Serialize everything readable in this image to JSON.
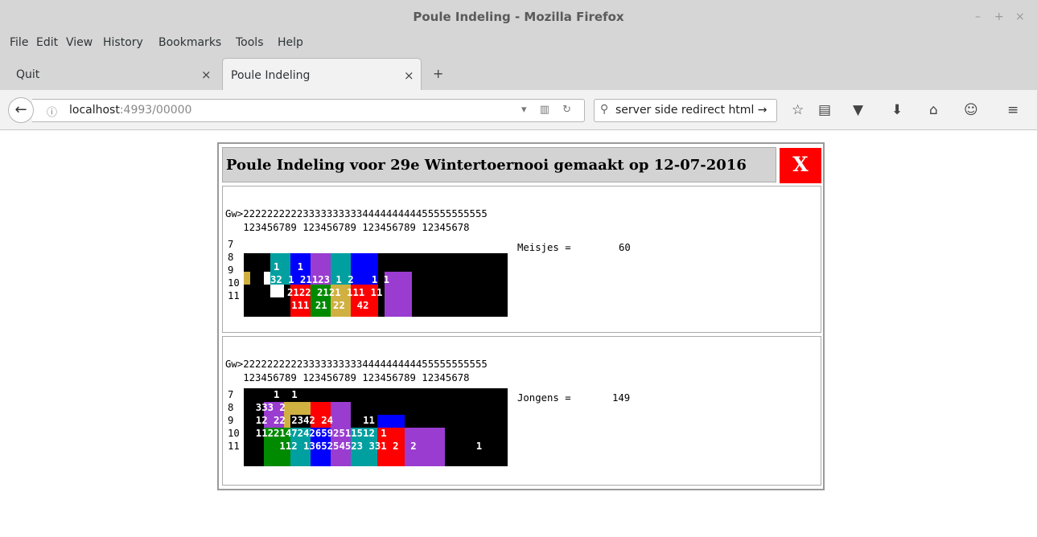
{
  "window": {
    "title": "Poule Indeling - Mozilla Firefox",
    "controls": [
      "–",
      "+",
      "×"
    ]
  },
  "menu": [
    "File",
    "Edit",
    "View",
    "History",
    "Bookmarks",
    "Tools",
    "Help"
  ],
  "tabs": [
    {
      "label": "Quit",
      "active": false
    },
    {
      "label": "Poule Indeling",
      "active": true
    }
  ],
  "tab_close": "×",
  "new_tab": "+",
  "nav": {
    "back_icon": "←",
    "info_icon": "ⓘ",
    "url_host": "localhost",
    "url_rest": ":4993/00000",
    "url_icons": "▾ ▥ ↻",
    "search_icon": "⚲",
    "search_text": "server side redirect html →",
    "toolbar_icons": [
      "☆",
      "▤",
      "▼",
      "⬇",
      "⌂",
      "☺",
      "≡"
    ]
  },
  "page": {
    "heading": "Poule Indeling voor 29e Wintertoernooi gemaakt op 12-07-2016",
    "close_label": "X",
    "header_line1": "Gw>22222222223333333333444444444455555555555",
    "header_line2": "   123456789 123456789 123456789 12345678",
    "row_labels": "7\n8\n9\n10\n11",
    "sections": [
      {
        "label": "Meisjes =",
        "count": "60",
        "rows": [
          "",
          "     1   1",
          "32 1 21123 1 2   1 1",
          "  11 2122 2121 111 11",
          "        111 21 22  42"
        ]
      },
      {
        "label": "Jongens =",
        "count": "149",
        "rows": [
          "     1  1",
          "  333 2",
          "  12 22 2342 24     11",
          "  11221472426592511512 1",
          "      112 1365254523 331 2  2          1"
        ]
      }
    ]
  },
  "colors": {
    "grid_bg": "#000000",
    "teal": "#00a0a0",
    "blue": "#0000ff",
    "purple": "#9a3cd0",
    "green": "#008a00",
    "red": "#ff0000",
    "olive": "#d0b040",
    "white": "#ffffff",
    "close_red": "#ff0000"
  }
}
